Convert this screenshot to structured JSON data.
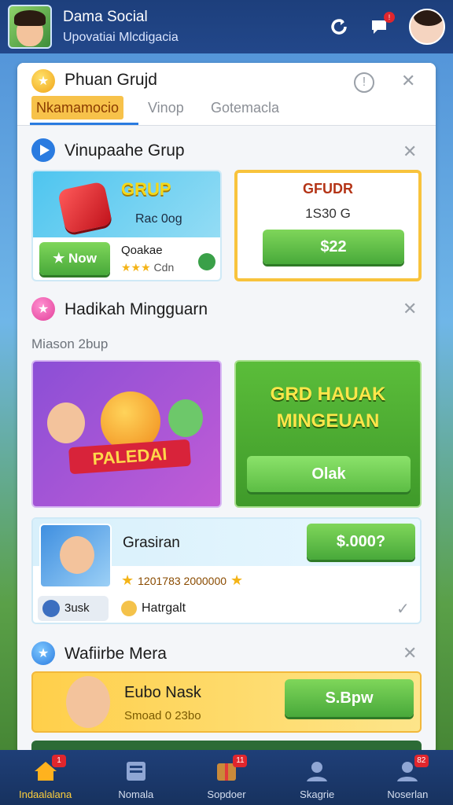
{
  "header": {
    "title": "Dama Social",
    "subtitle": "Upovatiai Mlcdigacia",
    "icons": [
      "refresh-icon",
      "chat-icon",
      "profile-avatar"
    ],
    "chat_badge": "!"
  },
  "sheet": {
    "title": "Phuan Grujd",
    "tabs": [
      "Nkamamocio",
      "Vinop",
      "Gotemacla"
    ],
    "info_icon": "!",
    "close": "✕"
  },
  "section1": {
    "title": "Vinupaahe Grup",
    "card_left": {
      "label": "GRUP",
      "price": "Rac 0og",
      "button": "Now",
      "rating_text": "Qoakae",
      "rating_sub": "Cdn"
    },
    "card_right": {
      "label": "GFUDR",
      "amount": "1S30 G",
      "button": "$22"
    }
  },
  "section2": {
    "title": "Hadikah Mingguarn",
    "subtitle": "Miason 2bup",
    "banner_text": "PALEDAI",
    "promo_title_1": "GRD HAUAK",
    "promo_title_2": "MINGEUAN",
    "promo_button": "Olak"
  },
  "offer_row": {
    "name": "Grasiran",
    "price_button": "$.000?",
    "stars_text": "1201783 2000000",
    "tag_label": "3usk",
    "hint_text": "Hatrgalt"
  },
  "section3": {
    "title": "Wafiirbe Mera",
    "card_title": "Eubo Nask",
    "card_sub": "Smoad 0 23bo",
    "button": "S.Bpw"
  },
  "bottom_nav": [
    {
      "label": "Indaalalana",
      "badge": "1"
    },
    {
      "label": "Nomala",
      "badge": ""
    },
    {
      "label": "Sopdoer",
      "badge": "11"
    },
    {
      "label": "Skagrie",
      "badge": ""
    },
    {
      "label": "Noserlan",
      "badge": "82"
    }
  ],
  "colors": {
    "accent_green": "#48a93a",
    "accent_yellow": "#f7c24a",
    "nav_blue": "#1f3f78"
  }
}
